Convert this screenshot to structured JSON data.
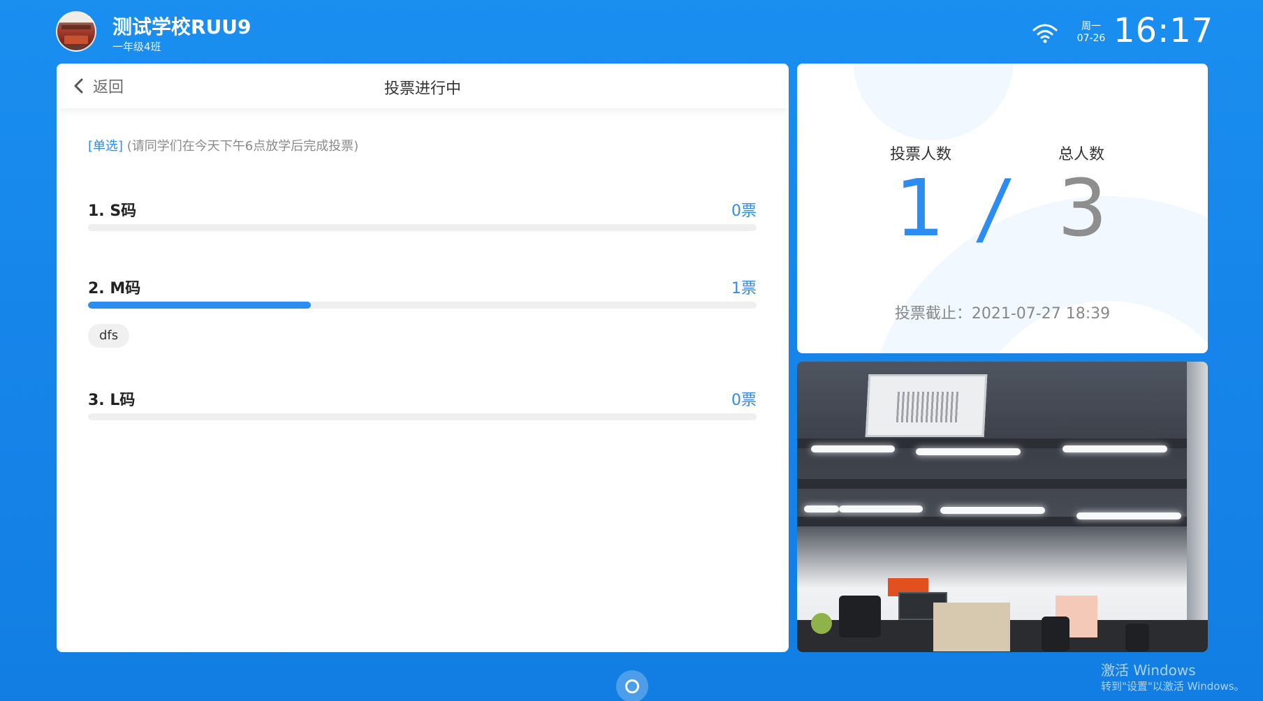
{
  "header": {
    "school_name": "测试学校RUU9",
    "class_name": "一年级4班",
    "weekday": "周一",
    "date": "07-26",
    "time": "16:17",
    "icons": [
      "school-avatar",
      "wifi-icon"
    ]
  },
  "poll": {
    "back_label": "返回",
    "title": "投票进行中",
    "type_tag": "[单选]",
    "note": "(请同学们在今天下午6点放学后完成投票)",
    "options": [
      {
        "label": "1.  S码",
        "votes": "0票",
        "fraction": 0.0,
        "voters": []
      },
      {
        "label": "2. M码",
        "votes": "1票",
        "fraction": 0.333,
        "voters": [
          "dfs"
        ]
      },
      {
        "label": "3. L码",
        "votes": "0票",
        "fraction": 0.0,
        "voters": []
      }
    ]
  },
  "stats": {
    "voted_label": "投票人数",
    "total_label": "总人数",
    "voted_count": "1",
    "separator": "/",
    "total_count": "3",
    "deadline": "投票截止：2021-07-27 18:39"
  },
  "colors": {
    "accent": "#2d8cf0",
    "background": "#1685ea",
    "text_dark": "#333333",
    "text_muted": "#888888"
  },
  "watermark": {
    "line1": "激活 Windows",
    "line2": "转到\"设置\"以激活 Windows。"
  }
}
